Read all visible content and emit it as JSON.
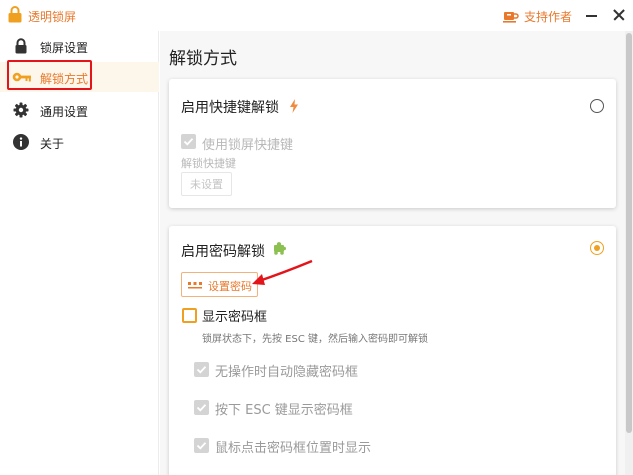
{
  "titlebar": {
    "app_title": "透明锁屏",
    "support_label": "支持作者",
    "icons": {
      "app": "padlock-icon",
      "support": "coffee-cup-icon",
      "minimize": "minimize-icon",
      "close": "close-icon"
    }
  },
  "sidebar": {
    "items": [
      {
        "label": "锁屏设置",
        "icon": "lock-icon",
        "active": false
      },
      {
        "label": "解锁方式",
        "icon": "key-icon",
        "active": true
      },
      {
        "label": "通用设置",
        "icon": "gear-icon",
        "active": false
      },
      {
        "label": "关于",
        "icon": "info-icon",
        "active": false
      }
    ]
  },
  "main": {
    "page_title": "解锁方式",
    "shortcut_card": {
      "title": "启用快捷键解锁",
      "title_icon": "lightning-icon",
      "selected": false,
      "use_shortcut_label": "使用锁屏快捷键",
      "use_shortcut_checked": true,
      "use_shortcut_disabled": true,
      "shortcut_field_label": "解锁快捷键",
      "shortcut_button": "未设置"
    },
    "password_card": {
      "title": "启用密码解锁",
      "title_icon": "puzzle-icon",
      "selected": true,
      "set_password_button": "设置密码",
      "show_box_label": "显示密码框",
      "show_box_checked": false,
      "hint": "锁屏状态下，先按 ESC 键，然后输入密码即可解锁",
      "options": [
        {
          "label": "无操作时自动隐藏密码框",
          "checked": true,
          "disabled": true
        },
        {
          "label": "按下 ESC 键显示密码框",
          "checked": true,
          "disabled": true
        },
        {
          "label": "鼠标点击密码框位置时显示",
          "checked": true,
          "disabled": true
        }
      ]
    }
  },
  "annotations": {
    "highlight_color": "#e3141a"
  },
  "colors": {
    "accent": "#e8792c",
    "radio_accent": "#f0a020",
    "disabled": "#d4d4d4"
  }
}
